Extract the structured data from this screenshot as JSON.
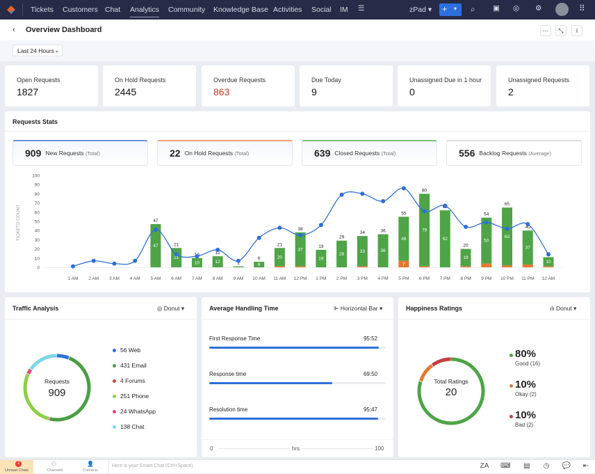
{
  "nav": {
    "items": [
      "Tickets",
      "Customers",
      "Chat",
      "Analytics",
      "Community",
      "Knowledge Base",
      "Activities",
      "Social",
      "IM"
    ],
    "active": "Analytics",
    "zpad": "zPad"
  },
  "header": {
    "title": "Overview Dashboard",
    "filter": "Last 24 Hours"
  },
  "stats": [
    {
      "label": "Open Requests",
      "value": "1827"
    },
    {
      "label": "On Hold Requests",
      "value": "2445"
    },
    {
      "label": "Overdue Requests",
      "value": "863",
      "color": "#c0392b"
    },
    {
      "label": "Due Today",
      "value": "9"
    },
    {
      "label": "Unassigned Due in 1 hour",
      "value": "0"
    },
    {
      "label": "Unassigned Requests",
      "value": "2"
    }
  ],
  "requests_stats": {
    "title": "Requests Stats",
    "summary": [
      {
        "value": "909",
        "label": "New Requests",
        "suffix": "(Total)",
        "color": "#6d8fd6"
      },
      {
        "value": "22",
        "label": "On Hold Requests",
        "suffix": "(Total)",
        "color": "#f0a070"
      },
      {
        "value": "639",
        "label": "Closed Requests",
        "suffix": "(Total)",
        "color": "#7cc27a"
      },
      {
        "value": "556",
        "label": "Backlog Requests",
        "suffix": "(Average)",
        "color": "#dddddd"
      }
    ]
  },
  "chart_data": {
    "type": "bar",
    "ylabel": "TICKETS COUNT",
    "ylim": [
      0,
      100
    ],
    "yticks": [
      0,
      10,
      20,
      30,
      40,
      50,
      60,
      70,
      80,
      90,
      100
    ],
    "categories": [
      "1 AM",
      "2 AM",
      "3 AM",
      "4 AM",
      "5 AM",
      "6 AM",
      "7 AM",
      "8 AM",
      "9 AM",
      "10 AM",
      "11 AM",
      "12 PM",
      "1 PM",
      "2 PM",
      "3 PM",
      "4 PM",
      "5 PM",
      "6 PM",
      "7 PM",
      "8 PM",
      "9 PM",
      "10 PM",
      "11 PM",
      "12 AM"
    ],
    "totals": [
      null,
      null,
      null,
      null,
      47,
      21,
      10,
      12,
      1,
      6,
      21,
      38,
      19,
      29,
      34,
      36,
      55,
      80,
      62,
      20,
      54,
      65,
      40,
      11
    ],
    "series": [
      {
        "name": "Closed Requests",
        "type": "bar",
        "color": "#4ea447",
        "values": [
          0,
          0,
          0,
          0,
          47,
          21,
          10,
          12,
          1,
          6,
          20,
          37,
          19,
          29,
          33,
          36,
          48,
          79,
          62,
          19,
          50,
          63,
          37,
          10
        ]
      },
      {
        "name": "On Hold Requests",
        "type": "bar",
        "color": "#e8772e",
        "values": [
          0,
          0,
          0,
          0,
          0,
          0,
          0,
          0,
          0,
          0,
          1,
          1,
          0,
          0,
          1,
          0,
          7,
          1,
          0,
          1,
          4,
          2,
          3,
          1
        ]
      },
      {
        "name": "Backlog Requests",
        "type": "line",
        "color": "#2f6fd6",
        "values": [
          1,
          7,
          4,
          7,
          41,
          14,
          12,
          19,
          7,
          32,
          43,
          35,
          46,
          79,
          80,
          72,
          86,
          61,
          67,
          44,
          49,
          42,
          47,
          14
        ]
      }
    ]
  },
  "traffic": {
    "title": "Traffic Analysis",
    "chart_type": "Donut",
    "center_label": "Requests",
    "center_value": "909",
    "items": [
      {
        "label": "56 Web",
        "value": 56,
        "color": "#2f6fd6"
      },
      {
        "label": "431 Email",
        "value": 431,
        "color": "#4a9e44"
      },
      {
        "label": "4 Forums",
        "value": 4,
        "color": "#d04545"
      },
      {
        "label": "251 Phone",
        "value": 251,
        "color": "#8ccf45"
      },
      {
        "label": "24 WhatsApp",
        "value": 24,
        "color": "#e0467a"
      },
      {
        "label": "138 Chat",
        "value": 138,
        "color": "#7dd6ea"
      }
    ]
  },
  "handling": {
    "title": "Average Handling Time",
    "chart_type": "Horizontal Bar",
    "axis": [
      "0",
      "hrs",
      "100"
    ],
    "items": [
      {
        "label": "First Response Time",
        "value": "95:52",
        "hours": 95.87
      },
      {
        "label": "Response time",
        "value": "69:50",
        "hours": 69.83
      },
      {
        "label": "Resolution time",
        "value": "95:47",
        "hours": 95.78
      }
    ]
  },
  "happiness": {
    "title": "Happiness Ratings",
    "chart_type": "Donut",
    "center_label": "Total Ratings",
    "center_value": "20",
    "items": [
      {
        "pct": "80%",
        "label": "Good (16)",
        "value": 16,
        "color": "#4ea447"
      },
      {
        "pct": "10%",
        "label": "Okay (2)",
        "value": 2,
        "color": "#e8772e"
      },
      {
        "pct": "10%",
        "label": "Bad (2)",
        "value": 2,
        "color": "#c83c3c"
      }
    ]
  },
  "bottombar": {
    "unread": "Unread Chats",
    "unread_count": "2",
    "channels": "Channels",
    "contacts": "Contacts",
    "smartchat": "Here is your Smart Chat (Ctrl+Space)"
  }
}
